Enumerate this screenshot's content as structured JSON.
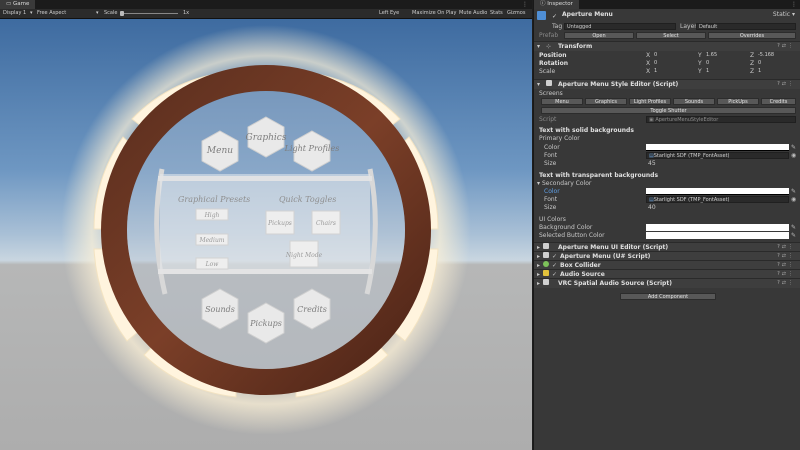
{
  "game": {
    "tab": "Game",
    "toolbar": {
      "display": "Display 1",
      "aspect": "Free Aspect",
      "scale_label": "Scale",
      "scale_value": "1x",
      "eye": "Left Eye",
      "maximize": "Maximize On Play",
      "mute": "Mute Audio",
      "stats": "Stats",
      "gizmos": "Gizmos"
    },
    "menu": {
      "top": [
        "Menu",
        "Graphics",
        "Light Profiles"
      ],
      "left_title": "Graphical Presets",
      "left_items": [
        "High",
        "Medium",
        "Low"
      ],
      "right_title": "Quick Toggles",
      "right_items": [
        "Pickups",
        "Chairs",
        "Night Mode"
      ],
      "bottom": [
        "Sounds",
        "Pickups",
        "Credits"
      ]
    }
  },
  "inspector": {
    "tab": "Inspector",
    "object_name": "Aperture Menu",
    "static_label": "Static",
    "tag_label": "Tag",
    "tag_value": "Untagged",
    "layer_label": "Layer",
    "layer_value": "Default",
    "prefab_label": "Prefab",
    "prefab_open": "Open",
    "prefab_select": "Select",
    "prefab_overrides": "Overrides",
    "transform": {
      "title": "Transform",
      "rows": [
        {
          "label": "Position",
          "x": "0",
          "y": "1.65",
          "z": "-5.168"
        },
        {
          "label": "Rotation",
          "x": "0",
          "y": "0",
          "z": "0"
        },
        {
          "label": "Scale",
          "x": "1",
          "y": "1",
          "z": "1"
        }
      ]
    },
    "style_editor": {
      "title": "Aperture Menu Style Editor (Script)",
      "screens_label": "Screens",
      "screen_buttons": [
        "Menu",
        "Graphics",
        "Light Profiles",
        "Sounds",
        "PickUps",
        "Credits"
      ],
      "toggle_shutter": "Toggle Shutter",
      "script_label": "Script",
      "script_value": "ApertureMenuStyleEditor",
      "solid_title": "Text with solid backgrounds",
      "primary_label": "Primary Color",
      "color_label": "Color",
      "font_label": "Font",
      "font_value": "Starlight SDF (TMP_FontAsset)",
      "size_label": "Size",
      "size_primary": "45",
      "transparent_title": "Text with transparent backgrounds",
      "secondary_label": "Secondary Color",
      "size_secondary": "40",
      "ui_colors_title": "UI Colors",
      "bg_color_label": "Background Color",
      "selected_color_label": "Selected Button Color"
    },
    "components": [
      {
        "name": "Aperture Menu UI Editor (Script)",
        "icon_color": "#d0d0d0"
      },
      {
        "name": "Aperture Menu (U# Script)",
        "icon_color": "#d0d0d0"
      },
      {
        "name": "Box Collider",
        "icon_color": "#7dc25a"
      },
      {
        "name": "Audio Source",
        "icon_color": "#e2c23c"
      },
      {
        "name": "VRC Spatial Audio Source (Script)",
        "icon_color": "#d0d0d0"
      }
    ],
    "add_component": "Add Component"
  }
}
